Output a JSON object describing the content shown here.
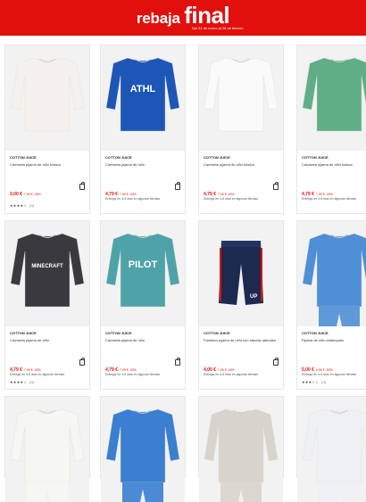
{
  "banner": {
    "title_word1": "rebaja",
    "title_word2": "final",
    "subtitle": "Del 31 de enero al 28 de febrero",
    "bg_color": "#e2100c"
  },
  "products": [
    {
      "brand": "COTTON JUICE",
      "name": "Camiseta pijama de niño básica",
      "price": "2,00 €",
      "discount": "7,99 € -40%",
      "delivery": "",
      "rating": "★★★★☆",
      "reviews": "(3)",
      "color": "#f4f1ec",
      "print": ""
    },
    {
      "brand": "COTTON JUICE",
      "name": "Camiseta pijama de niño",
      "price": "4,79 €",
      "discount": "7,99 € -40%",
      "delivery": "Entrega en 4-6 días en algunas tiendas",
      "rating": "",
      "reviews": "",
      "color": "#1e56b8",
      "print": "ATHL"
    },
    {
      "brand": "COTTON JUICE",
      "name": "Camiseta pijama de niño básica",
      "price": "4,79 €",
      "discount": "7,99 € -40%",
      "delivery": "Entrega en 4-6 días en algunas tiendas",
      "rating": "",
      "reviews": "",
      "color": "#fafafa",
      "print": ""
    },
    {
      "brand": "COTTON JUICE",
      "name": "Camiseta pijama de niño básica",
      "price": "4,79 €",
      "discount": "7,99 € -40%",
      "delivery": "Entrega en 4-6 días en algunas tiendas",
      "rating": "",
      "reviews": "",
      "color": "#5fae86",
      "print": ""
    },
    {
      "brand": "COTTON JUICE",
      "name": "Camiseta pijama de niño",
      "price": "4,79 €",
      "discount": "7,99 € -40%",
      "delivery": "Entrega en 4-6 días en algunas tiendas",
      "rating": "★★★★☆",
      "reviews": "(3)",
      "color": "#3a3a3e",
      "print": "MINECRAFT"
    },
    {
      "brand": "COTTON JUICE",
      "name": "Camiseta pijama de niño",
      "price": "4,79 €",
      "discount": "7,99 € -40%",
      "delivery": "Entrega en 4-6 días en algunas tiendas",
      "rating": "",
      "reviews": "",
      "color": "#4ea3a8",
      "print": "PILOT"
    },
    {
      "brand": "COTTON JUICE",
      "name": "Pantalón pijama de niño con bandas laterales",
      "price": "4,00 €",
      "discount": "7,99 € -40%",
      "delivery": "Entrega en 4-6 días en algunas tiendas",
      "rating": "",
      "reviews": "",
      "color": "#1b2a4e",
      "print": "UP"
    },
    {
      "brand": "COTTON JUICE",
      "name": "Pijama de niño estampado",
      "price": "5,00 €",
      "discount": "9,99 € -50%",
      "delivery": "Entrega en 4-6 días en algunas tiendas",
      "rating": "★★★☆☆",
      "reviews": "(3)",
      "color": "#4f8fd6",
      "print": ""
    },
    {
      "brand": "",
      "name": "",
      "price": "",
      "discount": "",
      "delivery": "",
      "rating": "",
      "reviews": "",
      "color": "#f6f6f2",
      "print": ""
    },
    {
      "brand": "",
      "name": "",
      "price": "",
      "discount": "",
      "delivery": "",
      "rating": "",
      "reviews": "",
      "color": "#3a7fd0",
      "print": ""
    },
    {
      "brand": "",
      "name": "",
      "price": "",
      "discount": "",
      "delivery": "",
      "rating": "",
      "reviews": "",
      "color": "#d8d4cc",
      "print": ""
    },
    {
      "brand": "",
      "name": "",
      "price": "",
      "discount": "",
      "delivery": "",
      "rating": "",
      "reviews": "",
      "color": "#eef0f4",
      "print": ""
    }
  ]
}
